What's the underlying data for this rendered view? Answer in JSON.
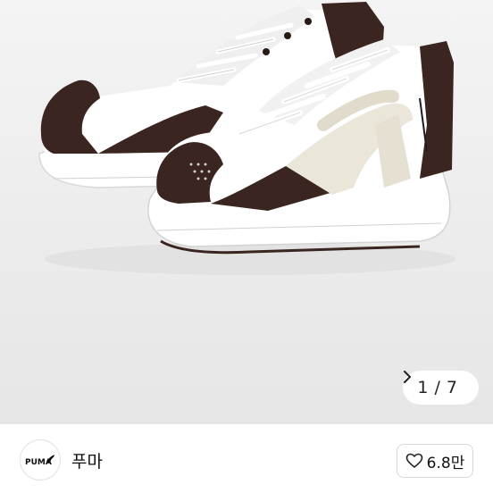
{
  "gallery": {
    "current": "1",
    "separator": "/",
    "total": "7"
  },
  "brand": {
    "logo_text": "PUMA",
    "name": "푸마"
  },
  "likes": {
    "count": "6.8만"
  },
  "icons": [
    "chevron-right-icon",
    "heart-outline-icon",
    "puma-logo"
  ]
}
